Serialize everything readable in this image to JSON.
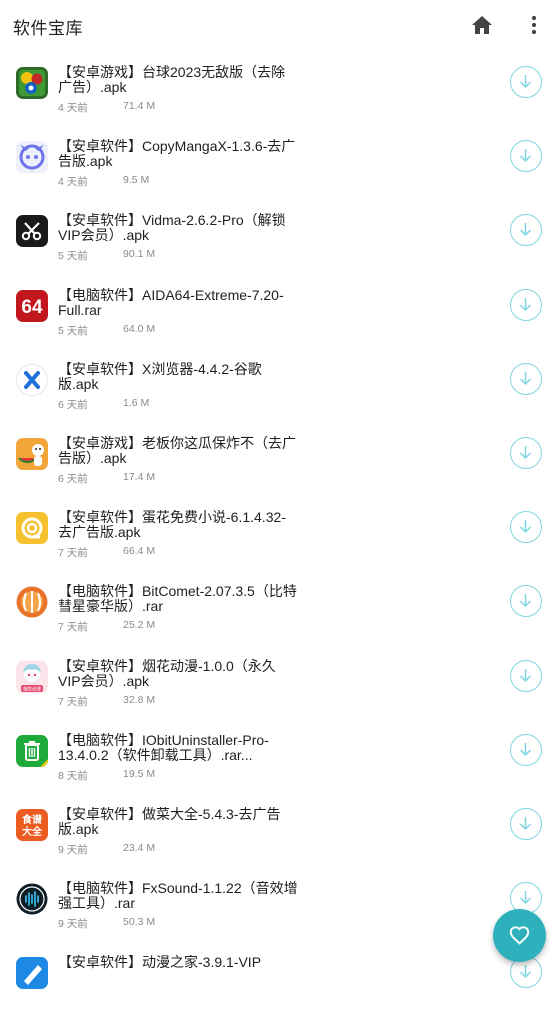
{
  "app": {
    "title": "软件宝库",
    "home_icon": "home-icon",
    "more_icon": "more-vert-icon",
    "accent": "#2fb1bd"
  },
  "items": [
    {
      "name": "【安卓游戏】台球2023无敌版（去除广告）.apk",
      "time": "4 天前",
      "size": "71.4 M",
      "icon": "billiards-icon"
    },
    {
      "name": "【安卓软件】CopyMangaX-1.3.6-去广告版.apk",
      "time": "4 天前",
      "size": "9.5 M",
      "icon": "copymanga-icon"
    },
    {
      "name": "【安卓软件】Vidma-2.6.2-Pro（解锁VIP会员）.apk",
      "time": "5 天前",
      "size": "90.1 M",
      "icon": "vidma-icon"
    },
    {
      "name": "【电脑软件】AIDA64-Extreme-7.20-Full.rar",
      "time": "5 天前",
      "size": "64.0 M",
      "icon": "aida64-icon"
    },
    {
      "name": "【安卓软件】X浏览器-4.4.2-谷歌版.apk",
      "time": "6 天前",
      "size": "1.6 M",
      "icon": "x-browser-icon"
    },
    {
      "name": "【安卓游戏】老板你这瓜保炸不（去广告版）.apk",
      "time": "6 天前",
      "size": "17.4 M",
      "icon": "watermelon-game-icon"
    },
    {
      "name": "【安卓软件】蛋花免费小说-6.1.4.32-去广告版.apk",
      "time": "7 天前",
      "size": "66.4 M",
      "icon": "danhua-novel-icon"
    },
    {
      "name": "【电脑软件】BitComet-2.07.3.5（比特彗星豪华版）.rar",
      "time": "7 天前",
      "size": "25.2 M",
      "icon": "bitcomet-icon"
    },
    {
      "name": "【安卓软件】烟花动漫-1.0.0（永久VIP会员）.apk",
      "time": "7 天前",
      "size": "32.8 M",
      "icon": "yanhua-anime-icon"
    },
    {
      "name": "【电脑软件】IObitUninstaller-Pro-13.4.0.2（软件卸载工具）.rar...",
      "time": "8 天前",
      "size": "19.5 M",
      "icon": "iobit-uninstaller-icon"
    },
    {
      "name": "【安卓软件】做菜大全-5.4.3-去广告版.apk",
      "time": "9 天前",
      "size": "23.4 M",
      "icon": "recipe-icon"
    },
    {
      "name": "【电脑软件】FxSound-1.1.22（音效增强工具）.rar",
      "time": "9 天前",
      "size": "50.3 M",
      "icon": "fxsound-icon"
    },
    {
      "name": "【安卓软件】动漫之家-3.9.1-VIP",
      "time": "",
      "size": "",
      "icon": "dmzj-icon"
    }
  ],
  "icon_texts": {
    "aida64": "64",
    "recipe_top": "食谱",
    "recipe_bottom": "大全",
    "yanhua_badge": "烟花动漫"
  },
  "fab": {
    "icon": "heart-icon"
  }
}
